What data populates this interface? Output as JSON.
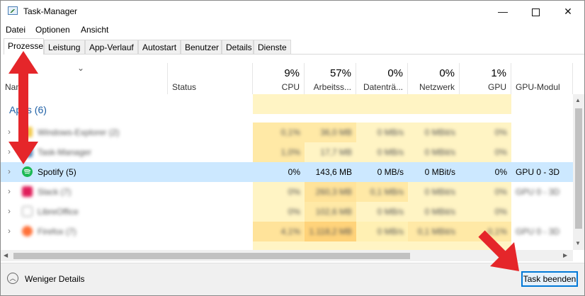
{
  "window": {
    "title": "Task-Manager",
    "min": "—",
    "close": "✕"
  },
  "menu": [
    "Datei",
    "Optionen",
    "Ansicht"
  ],
  "tabs": [
    "Prozesse",
    "Leistung",
    "App-Verlauf",
    "Autostart",
    "Benutzer",
    "Details",
    "Dienste"
  ],
  "header": {
    "name": "Name",
    "status": "Status",
    "cpu": {
      "pct": "9%",
      "label": "CPU"
    },
    "memory": {
      "pct": "57%",
      "label": "Arbeitss..."
    },
    "disk": {
      "pct": "0%",
      "label": "Datenträ..."
    },
    "network": {
      "pct": "0%",
      "label": "Netzwerk"
    },
    "gpu": {
      "pct": "1%",
      "label": "GPU"
    },
    "gpu_engine": "GPU-Modul"
  },
  "section_label": "Apps (6)",
  "rows": [
    {
      "name": "Windows-Explorer (2)",
      "cpu": "0,1%",
      "mem": "36,0 MB",
      "disk": "0 MB/s",
      "net": "0 MBit/s",
      "gpu": "0%",
      "engine": "",
      "blurred": true
    },
    {
      "name": "Task-Manager",
      "cpu": "1,0%",
      "mem": "17,7 MB",
      "disk": "0 MB/s",
      "net": "0 MBit/s",
      "gpu": "0%",
      "engine": "",
      "blurred": true
    },
    {
      "name": "Spotify (5)",
      "cpu": "0%",
      "mem": "143,6 MB",
      "disk": "0 MB/s",
      "net": "0 MBit/s",
      "gpu": "0%",
      "engine": "GPU 0 - 3D",
      "blurred": false
    },
    {
      "name": "Slack (7)",
      "cpu": "0%",
      "mem": "260,3 MB",
      "disk": "0,1 MB/s",
      "net": "0 MBit/s",
      "gpu": "0%",
      "engine": "GPU 0 - 3D",
      "blurred": true
    },
    {
      "name": "LibreOffice",
      "cpu": "0%",
      "mem": "102,6 MB",
      "disk": "0 MB/s",
      "net": "0 MBit/s",
      "gpu": "0%",
      "engine": "",
      "blurred": true
    },
    {
      "name": "Firefox (7)",
      "cpu": "4,1%",
      "mem": "1.118,2 MB",
      "disk": "0 MB/s",
      "net": "0,1 MBit/s",
      "gpu": "0,1%",
      "engine": "GPU 0 - 3D",
      "blurred": true
    }
  ],
  "footer": {
    "fewer_details": "Weniger Details",
    "end_task": "Task beenden"
  },
  "colors": {
    "accent": "#0078d7",
    "selection": "#cce8ff",
    "heat_light": "#fff4c4",
    "heat_strong": "#ffd37a",
    "annotation": "#e5262a",
    "spotify": "#1db954"
  }
}
